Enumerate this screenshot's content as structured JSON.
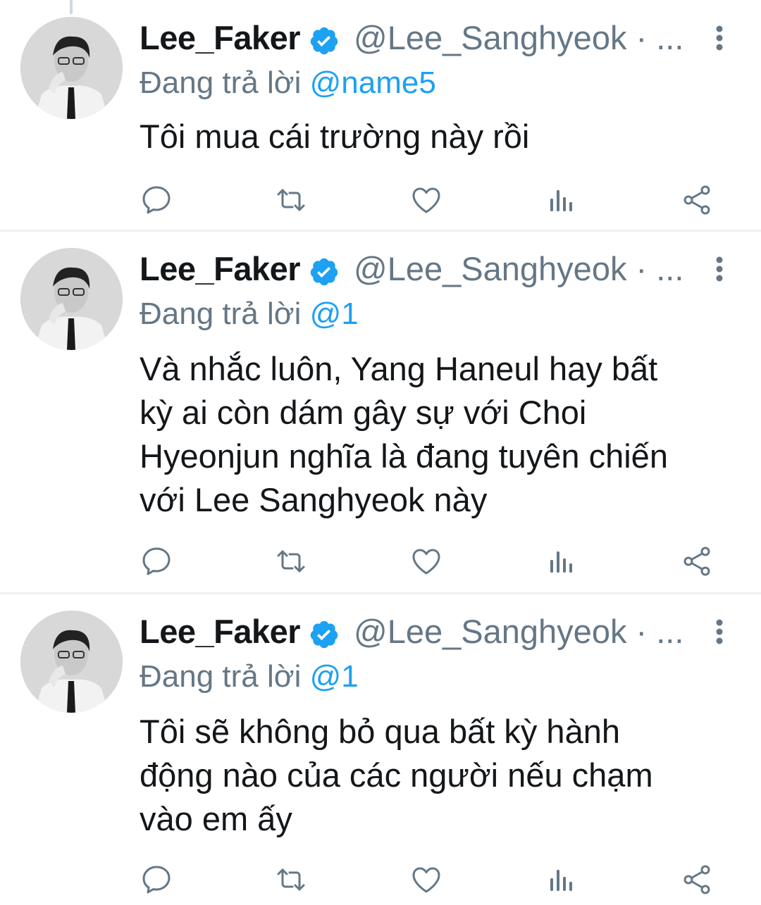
{
  "theme": {
    "accent": "#1da1f2",
    "text": "#14171a",
    "muted": "#657786",
    "icon": "#657786"
  },
  "tweets": [
    {
      "name": "Lee_Faker",
      "handle": "@Lee_Sanghyeok · ...",
      "replying_prefix": "Đang trả lời ",
      "replying_to": "@name5",
      "text": "Tôi mua cái trường này rồi",
      "actions": [
        "reply-icon",
        "retweet-icon",
        "like-icon",
        "stats-icon",
        "share-icon"
      ]
    },
    {
      "name": "Lee_Faker",
      "handle": "@Lee_Sanghyeok · ...",
      "replying_prefix": "Đang trả lời ",
      "replying_to": "@1",
      "text": "Và nhắc luôn, Yang Haneul hay bất\nkỳ ai còn dám gây sự với Choi\nHyeonjun nghĩa là đang tuyên chiến\nvới Lee Sanghyeok này",
      "actions": [
        "reply-icon",
        "retweet-icon",
        "like-icon",
        "stats-icon",
        "share-icon"
      ]
    },
    {
      "name": "Lee_Faker",
      "handle": "@Lee_Sanghyeok · ...",
      "replying_prefix": "Đang trả lời ",
      "replying_to": "@1",
      "text": "Tôi sẽ không bỏ qua bất kỳ hành\nđộng nào của các người nếu chạm\nvào em ấy",
      "actions": [
        "reply-icon",
        "retweet-icon",
        "like-icon",
        "stats-icon",
        "share-icon"
      ]
    }
  ]
}
